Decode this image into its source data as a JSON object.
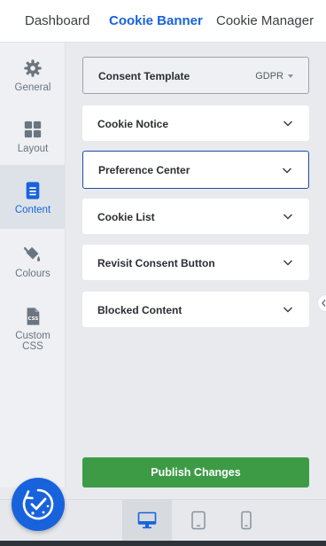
{
  "topnav": {
    "tabs": [
      {
        "label": "Dashboard"
      },
      {
        "label": "Cookie Banner"
      },
      {
        "label": "Cookie Manager"
      }
    ],
    "active": "Cookie Banner"
  },
  "sidebar": {
    "items": [
      {
        "label": "General",
        "icon": "gear-icon"
      },
      {
        "label": "Layout",
        "icon": "layout-grid-icon"
      },
      {
        "label": "Content",
        "icon": "document-icon"
      },
      {
        "label": "Colours",
        "icon": "paint-bucket-icon"
      },
      {
        "label_line1": "Custom",
        "label_line2": "CSS",
        "icon": "css-file-icon"
      }
    ],
    "active": "Content"
  },
  "panel": {
    "consent_template": {
      "label": "Consent Template",
      "value": "GDPR"
    },
    "sections": [
      {
        "label": "Cookie Notice"
      },
      {
        "label": "Preference Center"
      },
      {
        "label": "Cookie List"
      },
      {
        "label": "Revisit Consent Button"
      },
      {
        "label": "Blocked Content"
      }
    ],
    "active_section": "Preference Center",
    "publish_label": "Publish Changes"
  },
  "preview_devices": [
    {
      "name": "desktop",
      "icon": "desktop-icon",
      "active": true
    },
    {
      "name": "tablet",
      "icon": "tablet-icon",
      "active": false
    },
    {
      "name": "mobile",
      "icon": "mobile-icon",
      "active": false
    }
  ],
  "fab": {
    "icon": "consent-check-icon"
  },
  "colors": {
    "accent": "#1863dc",
    "publish": "#3d9b46",
    "active_border": "#1d4e9e"
  }
}
